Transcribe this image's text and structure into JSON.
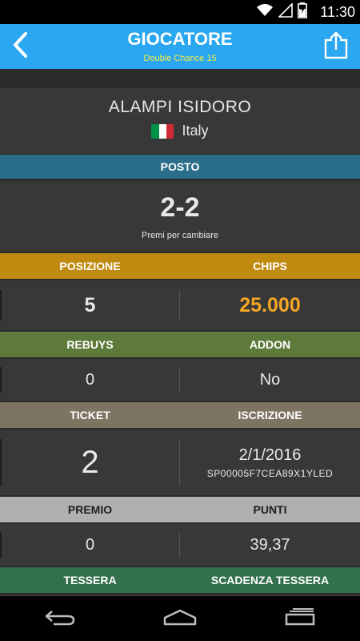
{
  "status_bar": {
    "time": "11:30",
    "icons": [
      "wifi-icon",
      "signal-icon",
      "battery-icon"
    ]
  },
  "app_bar": {
    "title": "GIOCATORE",
    "subtitle": "Double Chance 15",
    "back_icon": "chevron-left-icon",
    "share_icon": "share-icon"
  },
  "player": {
    "name": "ALAMPI ISIDORO",
    "country": "Italy"
  },
  "posto": {
    "header": "POSTO",
    "value": "2-2",
    "hint": "Premi per cambiare"
  },
  "sections": {
    "posizione_chips": {
      "left_label": "POSIZIONE",
      "right_label": "CHIPS",
      "left_value": "5",
      "right_value": "25.000"
    },
    "rebuys_addon": {
      "left_label": "REBUYS",
      "right_label": "ADDON",
      "left_value": "0",
      "right_value": "No"
    },
    "ticket_iscrizione": {
      "left_label": "TICKET",
      "right_label": "ISCRIZIONE",
      "left_value": "2",
      "right_value": "2/1/2016",
      "right_sub": "SP00005F7CEA89X1YLED"
    },
    "premio_punti": {
      "left_label": "PREMIO",
      "right_label": "PUNTI",
      "left_value": "0",
      "right_value": "39,37"
    },
    "tessera": {
      "left_label": "TESSERA",
      "right_label": "SCADENZA TESSERA"
    }
  },
  "colors": {
    "app_bar": "#2aa7f0",
    "subtitle": "#f5e94a",
    "posto_header": "#2a6e8a",
    "posizione_header": "#c08a10",
    "chips_value": "#f5a623",
    "rebuys_header": "#5e7a3a",
    "ticket_header": "#7d7462",
    "premio_header": "#b0b0b0",
    "tessera_header": "#33704c"
  },
  "nav_bar": {
    "icons": [
      "back-nav-icon",
      "home-nav-icon",
      "recents-nav-icon"
    ]
  }
}
